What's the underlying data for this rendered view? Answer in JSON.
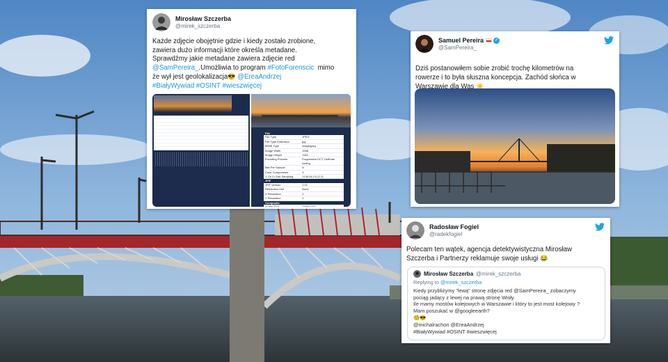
{
  "tweet1": {
    "author": "Mirosław Szczerba",
    "handle": "@mirek_szczerba",
    "line1": "Każde zdjęcie obojętnie gdzie i kiedy zostało zrobione,",
    "line2": "zawiera dużo informacji które określa metadane.",
    "line3": "Sprawdźmy jakie metadane zawiera zdjęcie red",
    "mention1": "@SamPereira_",
    "line4mid": ".Umożliwia to program ",
    "tag1": "#FotoForenscic",
    "line4end": "  mimo",
    "line5": "że wył jest geolokalizacja",
    "emoji1": "😎",
    "mention2": "@EreaAndrzej",
    "tag2": "#BiałyWywiad",
    "tag3": "#OSINT",
    "tag4": "#wieszwięcej",
    "exif_title": "File",
    "exif_rows": [
      {
        "k": "File Type",
        "v": "JPEG"
      },
      {
        "k": "File Type Extension",
        "v": "jpg"
      },
      {
        "k": "MIME Type",
        "v": "image/jpeg"
      },
      {
        "k": "Image Width",
        "v": "1568"
      },
      {
        "k": "Image Height",
        "v": "1182"
      },
      {
        "k": "Encoding Process",
        "v": "Progressive DCT, Huffman coding"
      },
      {
        "k": "Bits Per Sample",
        "v": "8"
      },
      {
        "k": "Color Components",
        "v": "3"
      },
      {
        "k": "Y Cb Cr Sub Sampling",
        "v": "YCbCr4:2:0 (2 2)"
      }
    ],
    "jfif_title": "JFIF",
    "jfif_rows": [
      {
        "k": "JFIF Version",
        "v": "1.01"
      },
      {
        "k": "Resolution Unit",
        "v": "None"
      },
      {
        "k": "X Resolution",
        "v": "1"
      },
      {
        "k": "Y Resolution",
        "v": "1"
      }
    ],
    "composite_title": "Composite",
    "composite_rows": [
      {
        "k": "Image Size",
        "v": "1568x1182"
      }
    ]
  },
  "tweet2": {
    "author": "Samuel Pereira",
    "handle": "@SamPereira_",
    "line1": "Dziś postanowiłem sobie zrobić trochę kilometrów na",
    "line2": "rowerze i to była słuszna koncepcja. Zachód słońca w",
    "line3": "Warszawie dla Was",
    "emoji": "☀️"
  },
  "tweet3": {
    "author": "Radosław Fogiel",
    "handle": "@radekfogiel",
    "line1": "Polecam ten wątek, agencja detektywistyczna Mirosław",
    "line2": "Szczerba i Partnerzy reklamuje swoje usługi",
    "emoji": "😂",
    "quote": {
      "author": "Mirosław Szczerba",
      "handle": "@mirek_szczerba",
      "replying_prefix": "Replying to ",
      "replying_to": "@mirek_szczerba",
      "line1": "Kiedy przybliżymy \"lewą\" stronę zdjęcia red @SamPereira_ zobaczymy",
      "line2": "pociąg jadący z lewej na prawą stronę Wisły.",
      "line3": "Ile mamy mostów kolejowych w Warszawie i który to jest most kolejowy ?",
      "line4": "Mam poszukać w @googleearth?",
      "emoji": "🧐😎",
      "line5": "@michalrachon @EreaAndrzej",
      "line6": "#BiałyWywiad #OSINT #wieszwięcej"
    }
  },
  "colors": {
    "twitter_blue": "#1da1f2",
    "link": "#1b95e0",
    "sky": "#6f9fd0",
    "bridge_red": "#a3262a",
    "exif_navy": "#1d2c4c"
  },
  "icons": {
    "bird": "twitter-bird-icon",
    "verified": "verified-badge-icon",
    "flag": "poland-flag-icon"
  }
}
